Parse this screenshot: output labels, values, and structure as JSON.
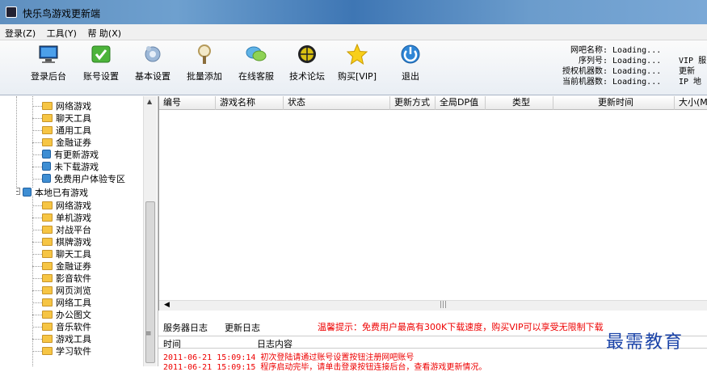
{
  "window": {
    "title": "快乐鸟游戏更新端"
  },
  "menu": [
    "登录(Z)",
    "工具(Y)",
    "帮 助(X)"
  ],
  "toolbar": {
    "buttons": [
      {
        "label": "登录后台",
        "icon": "monitor-icon"
      },
      {
        "label": "账号设置",
        "icon": "check-icon"
      },
      {
        "label": "基本设置",
        "icon": "gear-icon"
      },
      {
        "label": "批量添加",
        "icon": "magnifier-icon"
      },
      {
        "label": "在线客服",
        "icon": "chat-icon"
      },
      {
        "label": "技术论坛",
        "icon": "globe-icon"
      },
      {
        "label": "购买[VIP]",
        "icon": "star-icon"
      },
      {
        "label": "退出",
        "icon": "exit-icon"
      }
    ]
  },
  "info": {
    "rows": [
      {
        "key": "网吧名称:",
        "value": "Loading..."
      },
      {
        "key": "序列号:",
        "value": "Loading..."
      },
      {
        "key": "授权机器数:",
        "value": "Loading..."
      },
      {
        "key": "当前机器数:",
        "value": "Loading..."
      }
    ],
    "right": [
      "VIP 服",
      "更新",
      "IP 地"
    ]
  },
  "tree": {
    "group1_items": [
      {
        "label": "网络游戏",
        "type": "folder"
      },
      {
        "label": "聊天工具",
        "type": "folder"
      },
      {
        "label": "通用工具",
        "type": "folder"
      },
      {
        "label": "金融证券",
        "type": "folder"
      },
      {
        "label": "有更新游戏",
        "type": "special"
      },
      {
        "label": "未下载游戏",
        "type": "special"
      },
      {
        "label": "免费用户体验专区",
        "type": "special"
      }
    ],
    "root2": "本地已有游戏",
    "group2_items": [
      "网络游戏",
      "单机游戏",
      "对战平台",
      "棋牌游戏",
      "聊天工具",
      "金融证券",
      "影音软件",
      "网页浏览",
      "网络工具",
      "办公图文",
      "音乐软件",
      "游戏工具",
      "学习软件"
    ]
  },
  "table": {
    "columns": [
      "编号",
      "游戏名称",
      "状态",
      "更新方式",
      "全局DP值",
      "类型",
      "更新时间",
      "大小(M"
    ]
  },
  "log": {
    "tabs": [
      "服务器日志",
      "更新日志"
    ],
    "tip": "温馨提示：免费用户最高有300K下载速度，购买VIP可以享受无限制下载",
    "headers": [
      "时间",
      "日志内容"
    ],
    "lines": [
      {
        "time": "2011-06-21 15:09:14",
        "text": "初次登陆请通过账号设置按钮注册网吧账号"
      },
      {
        "time": "2011-06-21 15:09:15",
        "text": "程序启动完毕，请单击登录按钮连接后台，查看游戏更新情况。"
      }
    ]
  },
  "watermark": "最需教育"
}
